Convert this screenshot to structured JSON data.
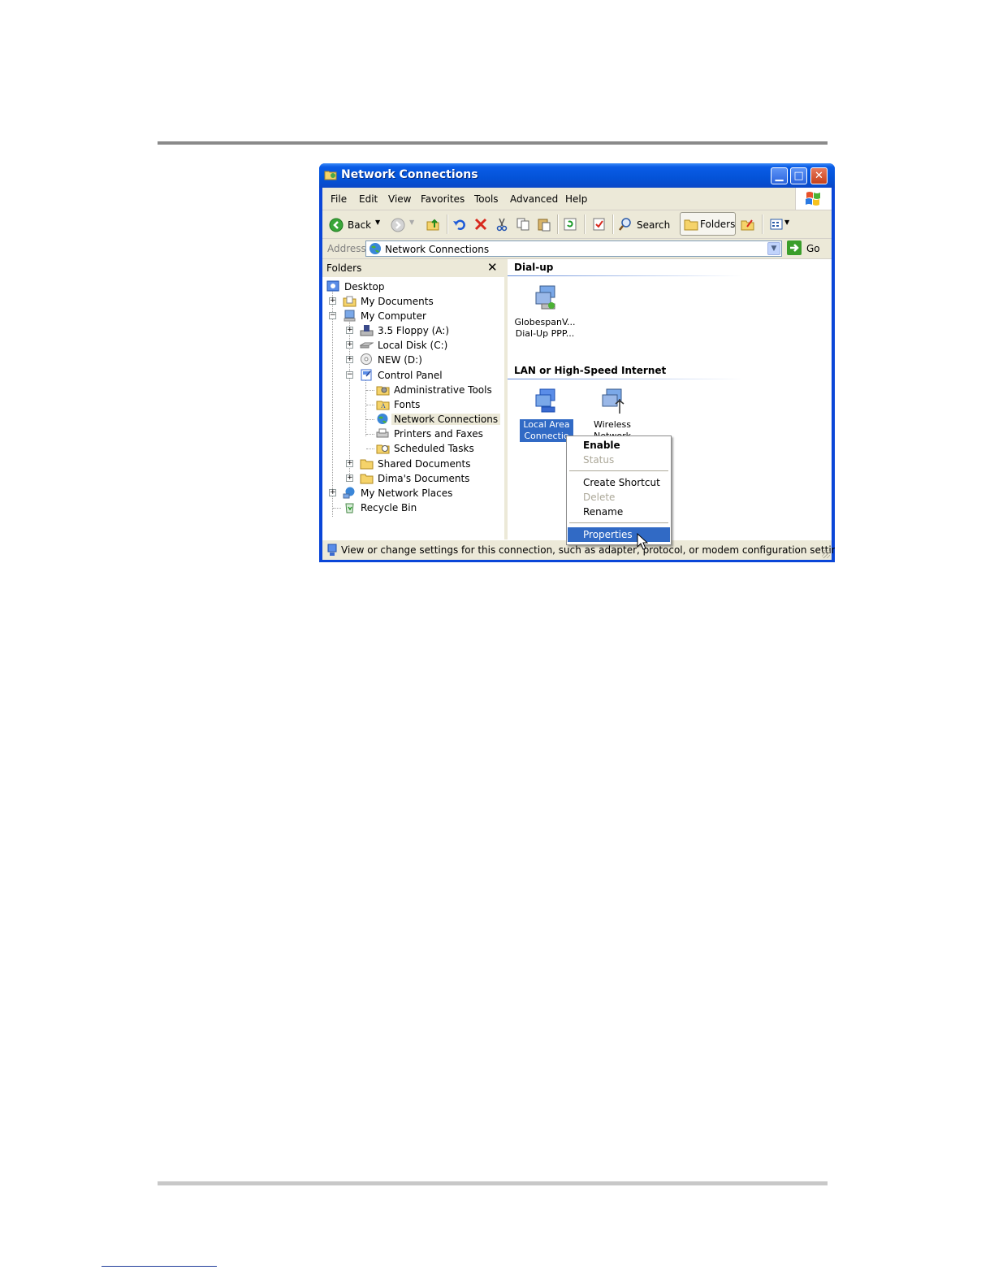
{
  "window": {
    "title": "Network Connections"
  },
  "menu": [
    "File",
    "Edit",
    "View",
    "Favorites",
    "Tools",
    "Advanced",
    "Help"
  ],
  "toolbar": {
    "back_label": "Back",
    "search_label": "Search",
    "folders_label": "Folders"
  },
  "address": {
    "label": "Address",
    "value": "Network Connections",
    "go_label": "Go"
  },
  "folders_pane": {
    "title": "Folders",
    "items": [
      {
        "label": "Desktop",
        "icon": "desktop-icon"
      },
      {
        "label": "My Documents",
        "icon": "my-documents-icon"
      },
      {
        "label": "My Computer",
        "icon": "my-computer-icon"
      },
      {
        "label": "3.5 Floppy (A:)",
        "icon": "floppy-drive-icon"
      },
      {
        "label": "Local Disk (C:)",
        "icon": "hard-disk-icon"
      },
      {
        "label": "NEW (D:)",
        "icon": "cd-drive-icon"
      },
      {
        "label": "Control Panel",
        "icon": "control-panel-icon"
      },
      {
        "label": "Administrative Tools",
        "icon": "admin-tools-icon"
      },
      {
        "label": "Fonts",
        "icon": "fonts-folder-icon"
      },
      {
        "label": "Network Connections",
        "icon": "network-connections-icon"
      },
      {
        "label": "Printers and Faxes",
        "icon": "printers-icon"
      },
      {
        "label": "Scheduled Tasks",
        "icon": "scheduled-tasks-icon"
      },
      {
        "label": "Shared Documents",
        "icon": "folder-icon"
      },
      {
        "label": "Dima's Documents",
        "icon": "folder-icon"
      },
      {
        "label": "My Network Places",
        "icon": "network-places-icon"
      },
      {
        "label": "Recycle Bin",
        "icon": "recycle-bin-icon"
      }
    ]
  },
  "content": {
    "groups": [
      {
        "title": "Dial-up",
        "items": [
          {
            "line1": "GlobespanV...",
            "line2": "Dial-Up PPP..."
          }
        ]
      },
      {
        "title": "LAN or High-Speed Internet",
        "items": [
          {
            "line1": "Local Area",
            "line2": "Connectio"
          },
          {
            "line1": "Wireless",
            "line2": "Network"
          }
        ]
      }
    ]
  },
  "context_menu": {
    "items": [
      "Enable",
      "Status",
      "Create Shortcut",
      "Delete",
      "Rename",
      "Properties"
    ]
  },
  "status_bar": {
    "text": "View or change settings for this connection, such as adapter, protocol, or modem configuration settings."
  },
  "colors": {
    "title_bar": "#0453d8",
    "selection": "#316ac5",
    "window_face": "#ece9d8"
  }
}
